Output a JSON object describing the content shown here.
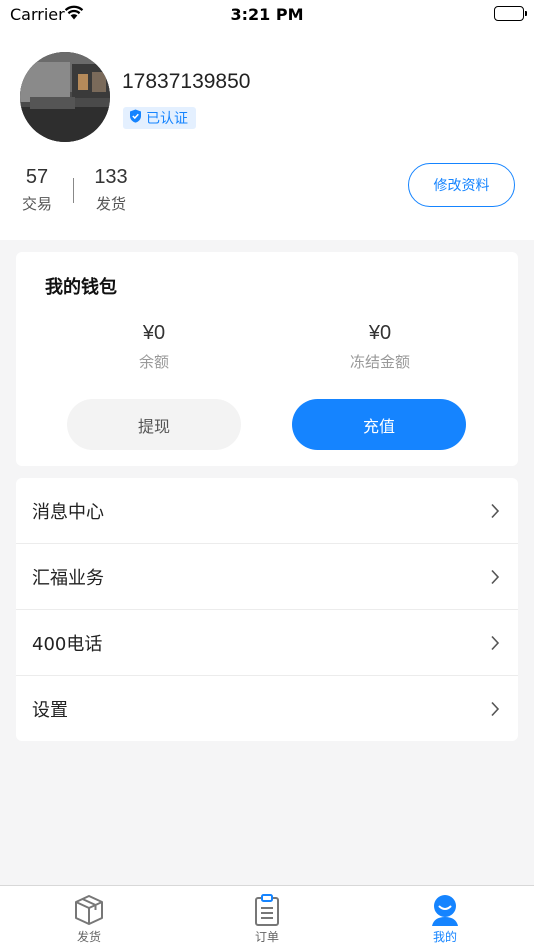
{
  "status_bar": {
    "carrier": "Carrier",
    "time": "3:21 PM"
  },
  "profile": {
    "phone": "17837139850",
    "verified_label": "已认证",
    "stats": [
      {
        "value": "57",
        "label": "交易"
      },
      {
        "value": "133",
        "label": "发货"
      }
    ],
    "edit_label": "修改资料"
  },
  "wallet": {
    "title": "我的钱包",
    "balance_amount": "¥0",
    "balance_label": "余额",
    "frozen_amount": "¥0",
    "frozen_label": "冻结金额",
    "withdraw_label": "提现",
    "recharge_label": "充值"
  },
  "menu": {
    "items": [
      {
        "label": "消息中心"
      },
      {
        "label": "汇福业务"
      },
      {
        "label": "400电话"
      },
      {
        "label": "设置"
      }
    ]
  },
  "tabbar": {
    "tabs": [
      {
        "label": "发货",
        "icon": "box-icon"
      },
      {
        "label": "订单",
        "icon": "clipboard-icon"
      },
      {
        "label": "我的",
        "icon": "user-icon"
      }
    ],
    "active": "我的"
  },
  "colors": {
    "accent": "#1584ff",
    "background": "#f5f5f6"
  }
}
